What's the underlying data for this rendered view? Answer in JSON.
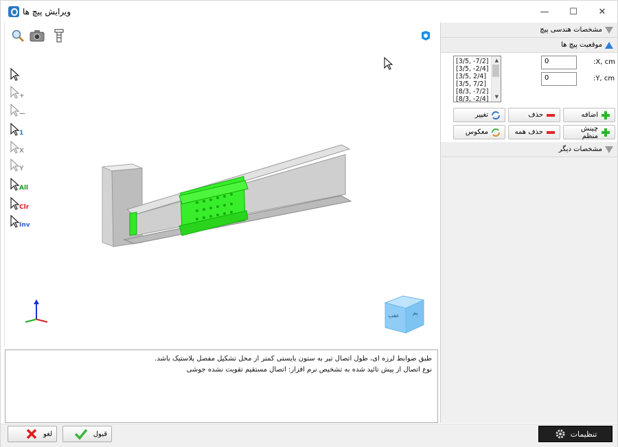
{
  "window": {
    "title": "ویرایش پیچ ها",
    "minimize": "—",
    "maximize": "☐",
    "close": "✕"
  },
  "toolbar": {
    "tools": [
      "zoom-icon",
      "camera-icon",
      "bolt-icon"
    ]
  },
  "cursor_tools": [
    {
      "name": "select",
      "sub": ""
    },
    {
      "name": "add",
      "sub": "+"
    },
    {
      "name": "remove",
      "sub": "—"
    },
    {
      "name": "one",
      "sub": "1"
    },
    {
      "name": "x",
      "sub": "X"
    },
    {
      "name": "y",
      "sub": "Y"
    },
    {
      "name": "all",
      "sub": "All"
    },
    {
      "name": "clear",
      "sub": "Clr"
    },
    {
      "name": "invert",
      "sub": "Inv"
    }
  ],
  "viewcube": {
    "face_back": "عقب",
    "face_side": "یم"
  },
  "message": {
    "line1": "طبق ضوابط لرزه ای، طول اتصال تیر به ستون بایستی کمتر از محل تشکیل مفصل پلاستیک باشد.",
    "line2": "نوع اتصال از پیش تائید شده به تشخیص نرم افزار: اتصال مستقیم تقویت نشده جوشی"
  },
  "panel": {
    "section_geometry": "مشخصات هندسی پیچ",
    "section_location": "موقعیت پیچ ها",
    "section_other": "مشخصات دیگر",
    "list_items": [
      "[3/5, -7/2]",
      "[3/5, -2/4]",
      "[3/5, 2/4]",
      "[3/5, 7/2]",
      "[8/3, -7/2]",
      "[8/3, -2/4]"
    ],
    "x_label": ":X, cm",
    "y_label": ":Y, cm",
    "x_value": "0",
    "y_value": "0",
    "btn_add": "اضافه",
    "btn_delete": "حذف",
    "btn_change": "تغییر",
    "btn_arrange": "چینش منظم",
    "btn_delete_all": "حذف همه",
    "btn_reverse": "معکوس"
  },
  "footer": {
    "settings": "تنظیمات",
    "accept": "قبول",
    "cancel": "لغو"
  },
  "colors": {
    "accent": "#2f7fd6",
    "bolt_green": "#22e01a",
    "steel": "#c8c8c8"
  }
}
